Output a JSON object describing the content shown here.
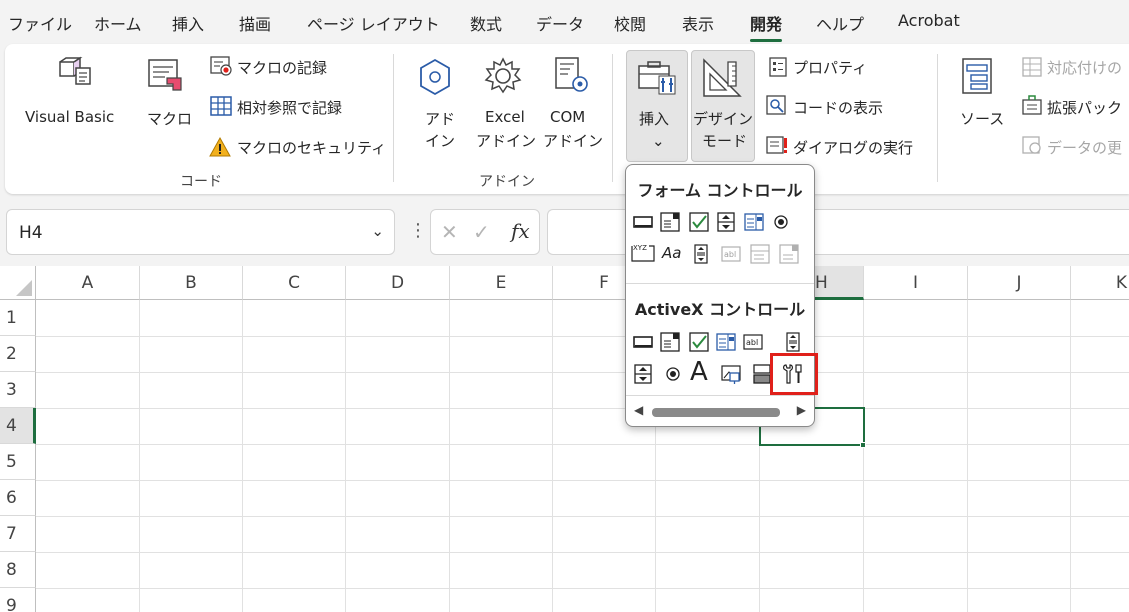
{
  "menu": {
    "file": "ファイル",
    "home": "ホーム",
    "insert": "挿入",
    "draw": "描画",
    "page_layout": "ページ レイアウト",
    "formulas": "数式",
    "data": "データ",
    "review": "校閲",
    "view": "表示",
    "developer": "開発",
    "help": "ヘルプ",
    "acrobat": "Acrobat"
  },
  "ribbon": {
    "code": {
      "visual_basic": "Visual Basic",
      "macros": "マクロ",
      "record_macro": "マクロの記録",
      "relative_ref": "相対参照で記録",
      "macro_security": "マクロのセキュリティ",
      "group_label": "コード"
    },
    "addins": {
      "addins_line1": "アド",
      "addins_line2": "イン",
      "excel_line1": "Excel",
      "excel_line2": "アドイン",
      "com_line1": "COM",
      "com_line2": "アドイン",
      "group_label": "アドイン"
    },
    "controls": {
      "insert": "挿入",
      "insert_arrow": "⌄",
      "design_line1": "デザイン",
      "design_line2": "モード",
      "properties": "プロパティ",
      "view_code": "コードの表示",
      "run_dialog": "ダイアログの実行"
    },
    "xml": {
      "source": "ソース",
      "map_properties": "対応付けの",
      "expansion_packs": "拡張パック",
      "refresh_data": "データの更"
    }
  },
  "formula_bar": {
    "name_box": "H4",
    "name_box_arrow": "⌄",
    "dots": "⋮",
    "cancel": "✕",
    "enter": "✓",
    "fx": "fx"
  },
  "grid": {
    "columns": [
      "A",
      "B",
      "C",
      "D",
      "E",
      "F",
      "H",
      "I",
      "J",
      "K"
    ],
    "rows": [
      "1",
      "2",
      "3",
      "4",
      "5",
      "6",
      "7",
      "8",
      "9"
    ],
    "selected_cell": "H4"
  },
  "dropdown": {
    "form_controls": "フォーム コントロール",
    "activex_controls": "ActiveX コントロール",
    "aa_label": "Aa",
    "abl_label": "abl",
    "xyz_label": "XYZ",
    "a_label": "A",
    "scroll_left": "◀",
    "scroll_right": "▶"
  },
  "colors": {
    "accent_green": "#1e6e3f",
    "highlight_red": "#e0201a",
    "ribbon_bg": "#f3f3f3"
  }
}
